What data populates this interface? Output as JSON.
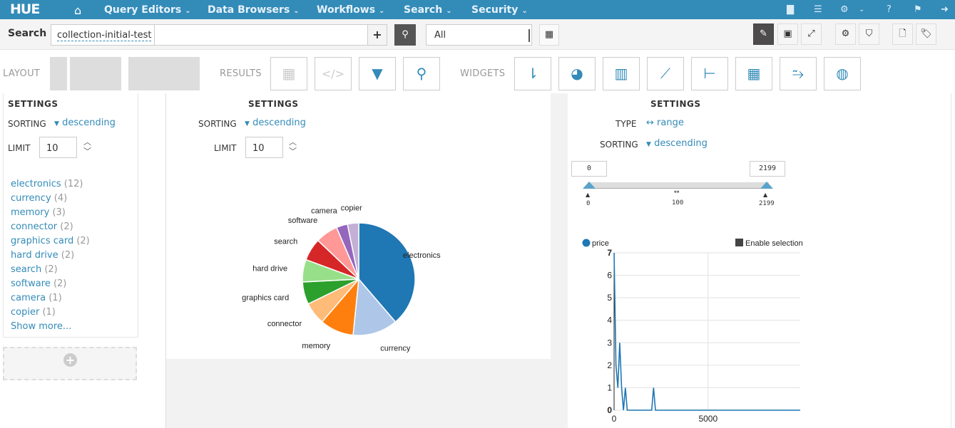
{
  "topnav": {
    "logo": "HUE",
    "menus": [
      {
        "label": "Query Editors"
      },
      {
        "label": "Data Browsers"
      },
      {
        "label": "Workflows"
      },
      {
        "label": "Search"
      },
      {
        "label": "Security"
      }
    ],
    "right_icons": [
      "file-icon",
      "jobs-icon",
      "cogs-icon",
      "chevron-down-icon",
      "help-icon",
      "flag-icon",
      "logout-icon"
    ]
  },
  "toolbar": {
    "search_label": "Search",
    "collection": "collection-initial-test",
    "query_value": "",
    "add_label": "+",
    "time_select": "All",
    "right_buttons": [
      "edit-icon",
      "save-icon",
      "expand-icon",
      "settings-icon",
      "bookmark-icon",
      "new-document-icon",
      "tags-icon"
    ]
  },
  "builder": {
    "layout_label": "LAYOUT",
    "results_label": "RESULTS",
    "widgets_label": "WIDGETS",
    "results_widgets": [
      "grid-icon",
      "html-icon",
      "filter-icon",
      "marker-icon"
    ],
    "widgets": [
      "text-facet-icon",
      "pie-chart-icon",
      "bar-chart-icon",
      "line-chart-icon",
      "tree-icon",
      "heatmap-icon",
      "timeline-icon",
      "map-icon"
    ]
  },
  "facet_panel": {
    "settings_title": "SETTINGS",
    "sorting_label": "SORTING",
    "sorting_value": "descending",
    "limit_label": "LIMIT",
    "limit_value": "10",
    "items": [
      {
        "label": "electronics",
        "count": "(12)"
      },
      {
        "label": "currency",
        "count": "(4)"
      },
      {
        "label": "memory",
        "count": "(3)"
      },
      {
        "label": "connector",
        "count": "(2)"
      },
      {
        "label": "graphics card",
        "count": "(2)"
      },
      {
        "label": "hard drive",
        "count": "(2)"
      },
      {
        "label": "search",
        "count": "(2)"
      },
      {
        "label": "software",
        "count": "(2)"
      },
      {
        "label": "camera",
        "count": "(1)"
      },
      {
        "label": "copier",
        "count": "(1)"
      }
    ],
    "show_more": "Show more..."
  },
  "pie_panel": {
    "settings_title": "SETTINGS",
    "sorting_label": "SORTING",
    "sorting_value": "descending",
    "limit_label": "LIMIT",
    "limit_value": "10"
  },
  "range_panel": {
    "settings_title": "SETTINGS",
    "type_label": "TYPE",
    "type_value": "range",
    "sorting_label": "SORTING",
    "sorting_value": "descending",
    "min_value": "0",
    "max_value": "2199",
    "slider_min_label": "0",
    "slider_step_label": "100",
    "slider_max_label": "2199",
    "legend_series": "price",
    "enable_selection": "Enable selection"
  },
  "colors": {
    "brand": "#338bb8",
    "link": "#338bb8"
  },
  "chart_data": [
    {
      "type": "pie",
      "title": "",
      "categories": [
        "electronics",
        "currency",
        "memory",
        "connector",
        "graphics card",
        "hard drive",
        "search",
        "software",
        "camera",
        "copier"
      ],
      "values": [
        12,
        4,
        3,
        2,
        2,
        2,
        2,
        2,
        1,
        1
      ],
      "colors": [
        "#1f77b4",
        "#aec7e8",
        "#ff7f0e",
        "#ffbb78",
        "#2ca02c",
        "#98df8a",
        "#d62728",
        "#ff9896",
        "#9467bd",
        "#c5b0d5"
      ]
    },
    {
      "type": "line",
      "title": "",
      "legend": [
        "price"
      ],
      "legend_position": "top-left",
      "xlabel": "",
      "ylabel": "",
      "xlim": [
        0,
        9900
      ],
      "ylim": [
        0,
        7
      ],
      "xticks": [
        0,
        5000
      ],
      "yticks": [
        0,
        1,
        2,
        3,
        4,
        5,
        6,
        7
      ],
      "grid": true,
      "series": [
        {
          "name": "price",
          "color": "#1f77b4",
          "x": [
            0,
            100,
            200,
            300,
            400,
            500,
            600,
            700,
            2000,
            2100,
            2200,
            9900
          ],
          "y": [
            7,
            2,
            1,
            3,
            1,
            0,
            1,
            0,
            0,
            1,
            0,
            0
          ]
        }
      ]
    }
  ]
}
